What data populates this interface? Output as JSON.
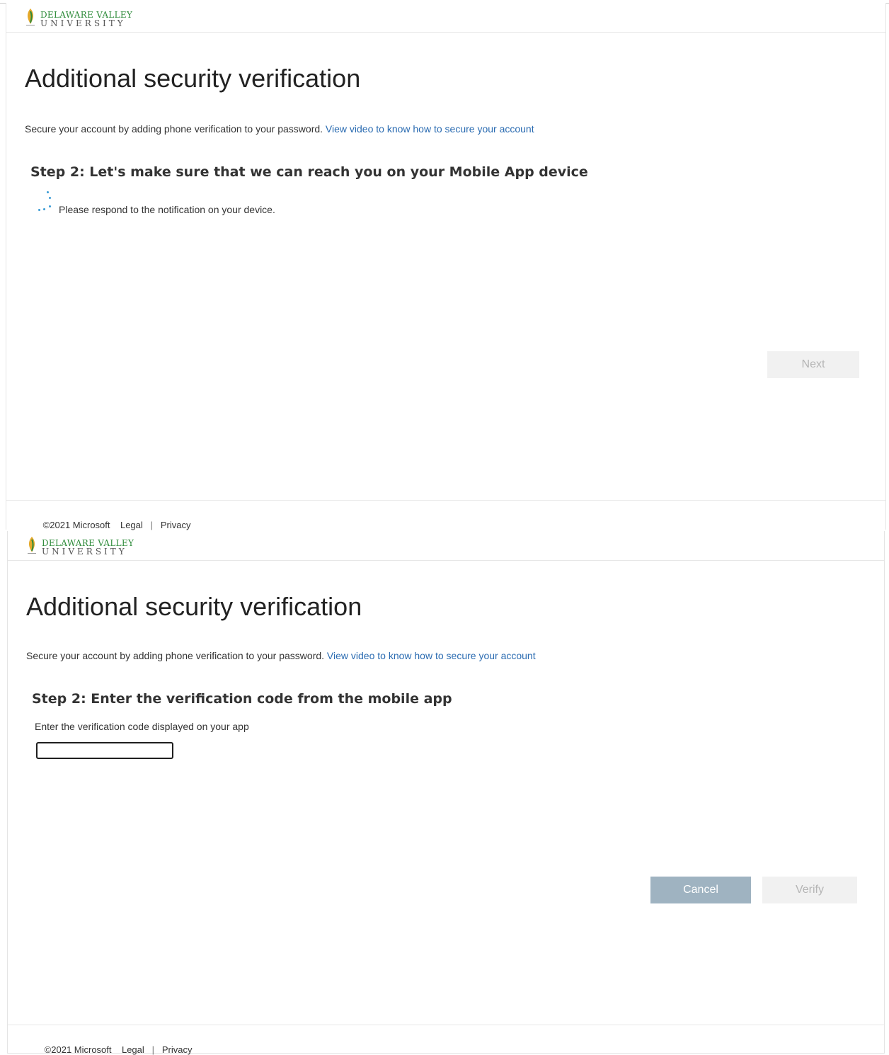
{
  "brand": {
    "line1": "DELAWARE VALLEY",
    "line2": "UNIVERSITY",
    "accent": "#2e8b3a"
  },
  "common": {
    "title": "Additional security verification",
    "desc_text": "Secure your account by adding phone verification to your password. ",
    "desc_link": "View video to know how to secure your account"
  },
  "screen1": {
    "step_title": "Step 2: Let's make sure that we can reach you on your Mobile App device",
    "note": "Please respond to the notification on your device.",
    "next_label": "Next"
  },
  "screen2": {
    "step_title": "Step 2: Enter the verification code from the mobile app",
    "instruction": "Enter the verification code displayed on your app",
    "code_value": "",
    "cancel_label": "Cancel",
    "verify_label": "Verify"
  },
  "footer": {
    "copyright": "©2021 Microsoft",
    "legal": "Legal",
    "separator": "|",
    "privacy": "Privacy"
  }
}
